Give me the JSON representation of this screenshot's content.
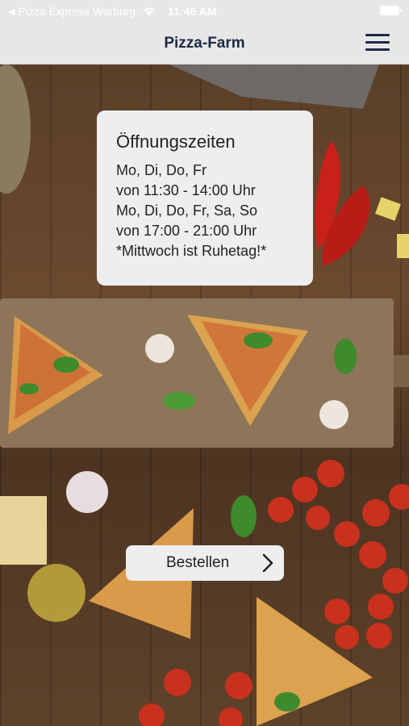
{
  "status_bar": {
    "back_arrow": "◀",
    "carrier": "Pizza Express Warburg",
    "time": "11:48 AM",
    "icons": [
      "wifi-icon",
      "battery-icon"
    ]
  },
  "nav": {
    "title": "Pizza-Farm",
    "menu_icon": "hamburger-menu-icon"
  },
  "hours": {
    "title": "Öffnungszeiten",
    "lines": [
      "Mo, Di, Do, Fr",
      "von 11:30 - 14:00 Uhr",
      "Mo, Di, Do, Fr, Sa, So",
      "von 17:00 - 21:00 Uhr",
      "*Mittwoch ist Ruhetag!*"
    ]
  },
  "order_button": {
    "label": "Bestellen",
    "icon": "chevron-right-icon"
  },
  "colors": {
    "navbar_bg": "#e7e7e7",
    "title_text": "#1e2a44",
    "card_bg": "#eeeeee"
  }
}
